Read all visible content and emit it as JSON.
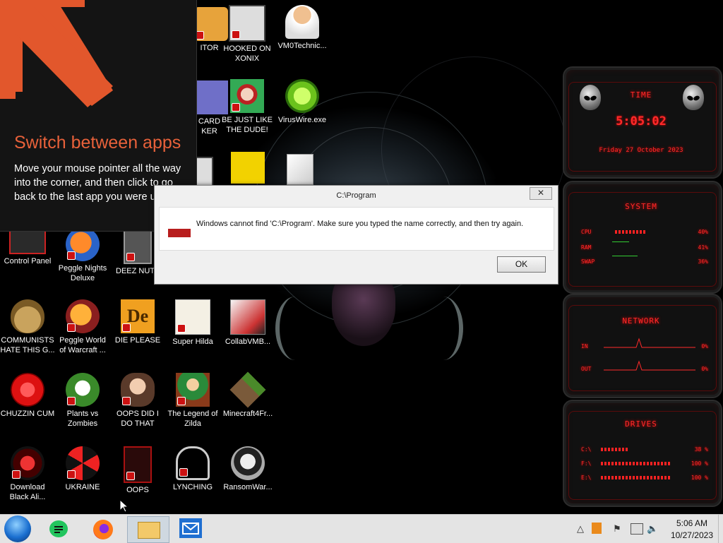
{
  "tip": {
    "title": "Switch between apps",
    "body": "Move your mouse pointer all the way into the corner, and then click to go back to the last app you were using."
  },
  "dialog": {
    "title": "C:\\Program",
    "message": "Windows cannot find 'C:\\Program'. Make sure you typed the name correctly, and then try again.",
    "ok_label": "OK",
    "close_glyph": "✕"
  },
  "desktop_icons": [
    {
      "label": "ITOR"
    },
    {
      "label": "HOOKED ON XONIX"
    },
    {
      "label": "VM0Technic..."
    },
    {
      "label": "CARD KER"
    },
    {
      "label": "BE JUST LIKE THE DUDE!"
    },
    {
      "label": "VirusWire.exe"
    },
    {
      "label": "Control Panel"
    },
    {
      "label": "Peggle Nights Deluxe"
    },
    {
      "label": "DEEZ NUT"
    },
    {
      "label": "COMMUNISTS HATE THIS G..."
    },
    {
      "label": "Peggle World of Warcraft ..."
    },
    {
      "label": "DIE PLEASE"
    },
    {
      "label": "Super Hilda"
    },
    {
      "label": "CollabVMB..."
    },
    {
      "label": "CHUZZIN CUM"
    },
    {
      "label": "Plants vs Zombies"
    },
    {
      "label": "OOPS DID I DO THAT"
    },
    {
      "label": "The Legend of Zilda"
    },
    {
      "label": "Minecraft4Fr..."
    },
    {
      "label": "Download Black Ali..."
    },
    {
      "label": "UKRAINE"
    },
    {
      "label": "OOPS"
    },
    {
      "label": "LYNCHING"
    },
    {
      "label": "RansomWar..."
    }
  ],
  "gadgets": {
    "time": {
      "title": "TIME",
      "clock": "5:05:02",
      "date": "Friday 27 October 2023"
    },
    "system": {
      "title": "SYSTEM",
      "rows": [
        {
          "label": "CPU",
          "value": "40%",
          "level": 0.4
        },
        {
          "label": "RAM",
          "value": "41%",
          "level": 0.41
        },
        {
          "label": "SWAP",
          "value": "36%",
          "level": 0.36
        }
      ]
    },
    "network": {
      "title": "NETWORK",
      "rows": [
        {
          "label": "IN",
          "value": "0%"
        },
        {
          "label": "OUT",
          "value": "0%"
        }
      ]
    },
    "drives": {
      "title": "DRIVES",
      "rows": [
        {
          "label": "C:\\",
          "value": "38 %",
          "level": 0.38
        },
        {
          "label": "F:\\",
          "value": "100 %",
          "level": 1.0
        },
        {
          "label": "E:\\",
          "value": "100 %",
          "level": 1.0
        }
      ]
    }
  },
  "taskbar": {
    "time": "5:06 AM",
    "date": "10/27/2023",
    "items": [
      "start-orb",
      "notes-app",
      "firefox",
      "file-explorer",
      "mail"
    ],
    "tray": {
      "show_hidden": "△",
      "flag": "⚑",
      "volume": "🔈"
    }
  },
  "colors": {
    "accent_orange": "#e8613a",
    "gadget_red": "#ff2a2a",
    "taskbar_bg": "#e4e4e4"
  }
}
